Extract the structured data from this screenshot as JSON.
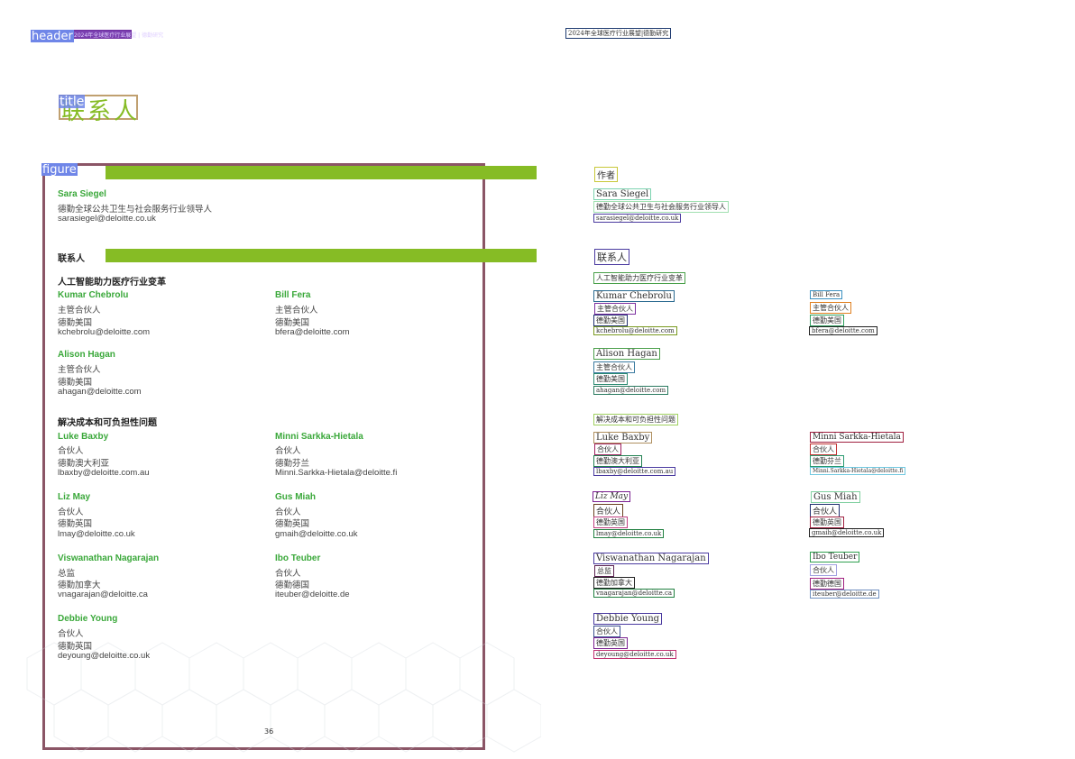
{
  "tags": {
    "header": "header",
    "title": "title",
    "figure": "figure"
  },
  "header": {
    "left_text": "2024年全球医疗行业展望 | 德勤研究",
    "right_text": "2024年全球医疗行业展望|德勤研究"
  },
  "title": "联系人",
  "page_number": "36",
  "left": {
    "section_authors_label": "作者",
    "author": {
      "name": "Sara Siegel",
      "role": "德勤全球公共卫生与社会服务行业领导人",
      "email": "sarasiegel@deloitte.co.uk"
    },
    "section_contacts_label": "联系人",
    "topic1": "人工智能助力医疗行业变革",
    "topic2": "解决成本和可负担性问题",
    "contacts": [
      {
        "name": "Kumar Chebrolu",
        "title": "主管合伙人",
        "org": "德勤美国",
        "email": "kchebrolu@deloitte.com"
      },
      {
        "name": "Bill Fera",
        "title": "主管合伙人",
        "org": "德勤美国",
        "email": "bfera@deloitte.com"
      },
      {
        "name": "Alison Hagan",
        "title": "主管合伙人",
        "org": "德勤美国",
        "email": "ahagan@deloitte.com"
      },
      {
        "name": "Luke Baxby",
        "title": "合伙人",
        "org": "德勤澳大利亚",
        "email": "lbaxby@deloitte.com.au"
      },
      {
        "name": "Minni Sarkka-Hietala",
        "title": "合伙人",
        "org": "德勤芬兰",
        "email": "Minni.Sarkka-Hietala@deloitte.fi"
      },
      {
        "name": "Liz May",
        "title": "合伙人",
        "org": "德勤英国",
        "email": "lmay@deloitte.co.uk"
      },
      {
        "name": "Gus Miah",
        "title": "合伙人",
        "org": "德勤英国",
        "email": "gmaih@deloitte.co.uk"
      },
      {
        "name": "Viswanathan Nagarajan",
        "title": "总监",
        "org": "德勤加拿大",
        "email": "vnagarajan@deloitte.ca"
      },
      {
        "name": "Ibo Teuber",
        "title": "合伙人",
        "org": "德勤德国",
        "email": "iteuber@deloitte.de"
      },
      {
        "name": "Debbie Young",
        "title": "合伙人",
        "org": "德勤英国",
        "email": "deyoung@deloitte.co.uk"
      }
    ]
  },
  "right": {
    "authors_label": "作者",
    "author_name": "Sara Siegel",
    "author_role": "德勤全球公共卫生与社会服务行业领导人",
    "author_email": "sarasiegel@deloitte.co.uk",
    "contacts_label": "联系人",
    "topic1": "人工智能助力医疗行业变革",
    "topic2": "解决成本和可负担性问题",
    "kumar_name": "Kumar Chebrolu",
    "kumar_title": "主管合伙人",
    "kumar_org": "德勤美国",
    "kumar_email": "kchebrolu@deloitte.com",
    "bill_name": "Bill Fera",
    "bill_title": "主管合伙人",
    "bill_org": "德勤美国",
    "bill_email": "bfera@deloitte.com",
    "alison_name": "Alison Hagan",
    "alison_title": "主管合伙人",
    "alison_org": "德勤美国",
    "alison_email": "ahagan@deloitte.com",
    "luke_name": "Luke Baxby",
    "luke_title": "合伙人",
    "luke_org": "德勤澳大利亚",
    "luke_email": "lbaxby@deloitte.com.au",
    "minni_name": "Minni Sarkka-Hietala",
    "minni_title": "合伙人",
    "minni_org": "德勤芬兰",
    "minni_email": "Minni.Sarkka-Hietala@deloitte.fi",
    "liz_name": "Liz May",
    "liz_title": "合伙人",
    "liz_org": "德勤英国",
    "liz_email": "lmay@deloitte.co.uk",
    "gus_name": "Gus Miah",
    "gus_title": "合伙人",
    "gus_org": "德勤英国",
    "gus_email": "gmaih@deloitte.co.uk",
    "vis_name": "Viswanathan Nagarajan",
    "vis_title": "总监",
    "vis_org": "德勤加拿大",
    "vis_email": "vnagarajan@deloitte.ca",
    "ibo_name": "Ibo Teuber",
    "ibo_title": "合伙人",
    "ibo_org": "德勤德国",
    "ibo_email": "iteuber@deloitte.de",
    "debbie_name": "Debbie Young",
    "debbie_title": "合伙人",
    "debbie_org": "德勤英国",
    "debbie_email": "deyoung@deloitte.co.uk"
  },
  "colors": {
    "brand_green": "#86bc25",
    "name_green": "#3aa83a",
    "figure_border": "#8b5566",
    "title_border": "#c0a070",
    "tag_bg": "#6f86e8"
  }
}
